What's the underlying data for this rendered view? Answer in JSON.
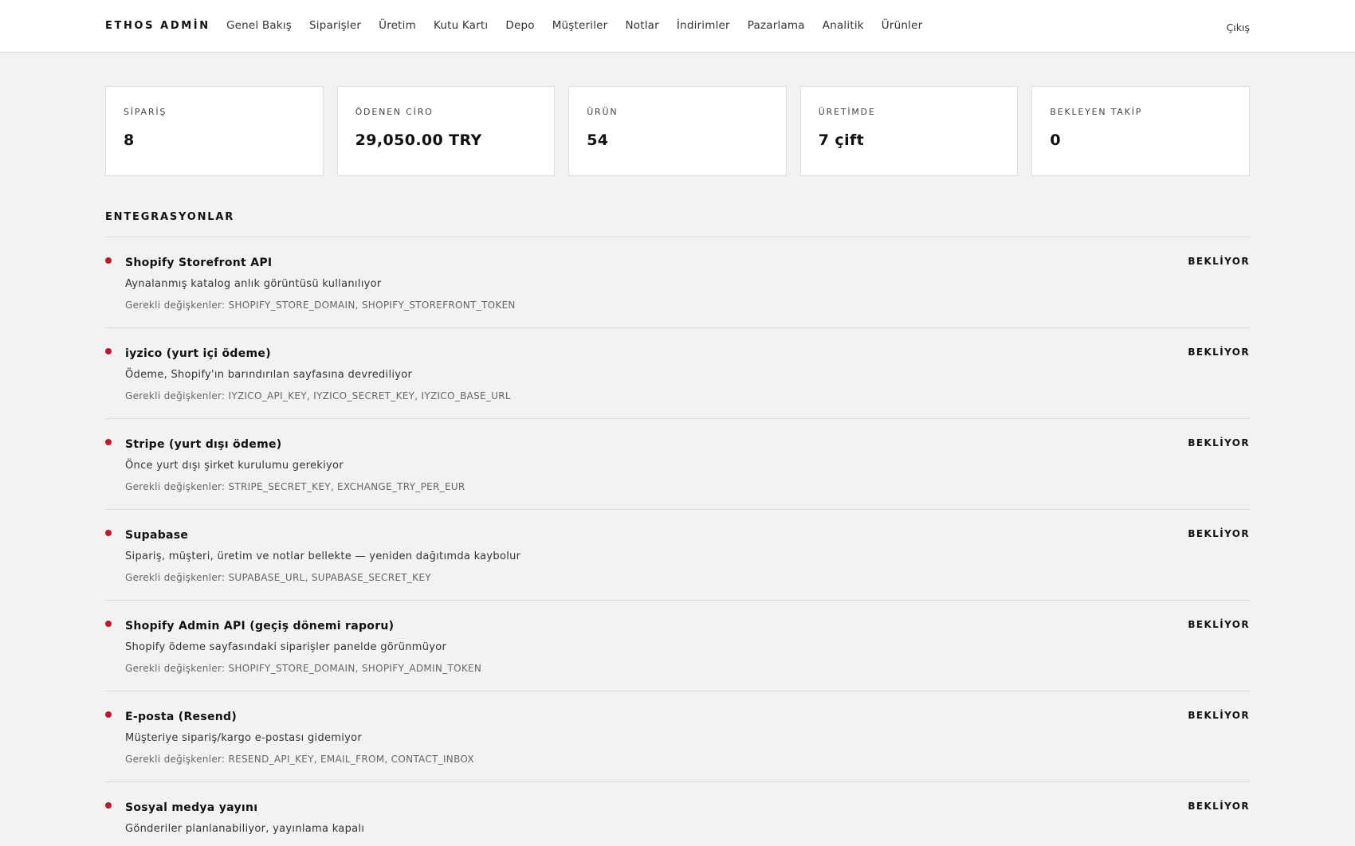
{
  "header": {
    "brand": "ETHOS ADMİN",
    "nav": [
      "Genel Bakış",
      "Siparişler",
      "Üretim",
      "Kutu Kartı",
      "Depo",
      "Müşteriler",
      "Notlar",
      "İndirimler",
      "Pazarlama",
      "Analitik",
      "Ürünler"
    ],
    "logout": "Çıkış"
  },
  "stats": [
    {
      "label": "SİPARİŞ",
      "value": "8"
    },
    {
      "label": "ÖDENEN CİRO",
      "value": "29,050.00 TRY"
    },
    {
      "label": "ÜRÜN",
      "value": "54"
    },
    {
      "label": "ÜRETİMDE",
      "value": "7 çift"
    },
    {
      "label": "BEKLEYEN TAKİP",
      "value": "0"
    }
  ],
  "integrations_title": "ENTEGRASYONLAR",
  "integrations": [
    {
      "name": "Shopify Storefront API",
      "description": "Aynalanmış katalog anlık görüntüsü kullanılıyor",
      "vars": "Gerekli değişkenler: SHOPIFY_STORE_DOMAIN, SHOPIFY_STOREFRONT_TOKEN",
      "status": "BEKLİYOR"
    },
    {
      "name": "iyzico (yurt içi ödeme)",
      "description": "Ödeme, Shopify'ın barındırılan sayfasına devrediliyor",
      "vars": "Gerekli değişkenler: IYZICO_API_KEY, IYZICO_SECRET_KEY, IYZICO_BASE_URL",
      "status": "BEKLİYOR"
    },
    {
      "name": "Stripe (yurt dışı ödeme)",
      "description": "Önce yurt dışı şirket kurulumu gerekiyor",
      "vars": "Gerekli değişkenler: STRIPE_SECRET_KEY, EXCHANGE_TRY_PER_EUR",
      "status": "BEKLİYOR"
    },
    {
      "name": "Supabase",
      "description": "Sipariş, müşteri, üretim ve notlar bellekte — yeniden dağıtımda kaybolur",
      "vars": "Gerekli değişkenler: SUPABASE_URL, SUPABASE_SECRET_KEY",
      "status": "BEKLİYOR"
    },
    {
      "name": "Shopify Admin API (geçiş dönemi raporu)",
      "description": "Shopify ödeme sayfasındaki siparişler panelde görünmüyor",
      "vars": "Gerekli değişkenler: SHOPIFY_STORE_DOMAIN, SHOPIFY_ADMIN_TOKEN",
      "status": "BEKLİYOR"
    },
    {
      "name": "E-posta (Resend)",
      "description": "Müşteriye sipariş/kargo e-postası gidemiyor",
      "vars": "Gerekli değişkenler: RESEND_API_KEY, EMAIL_FROM, CONTACT_INBOX",
      "status": "BEKLİYOR"
    },
    {
      "name": "Sosyal medya yayını",
      "description": "Gönderiler planlanabiliyor, yayınlama kapalı",
      "vars": "",
      "status": "BEKLİYOR"
    }
  ],
  "colors": {
    "status_dot": "#c0182c",
    "background": "#f2f2f0"
  }
}
